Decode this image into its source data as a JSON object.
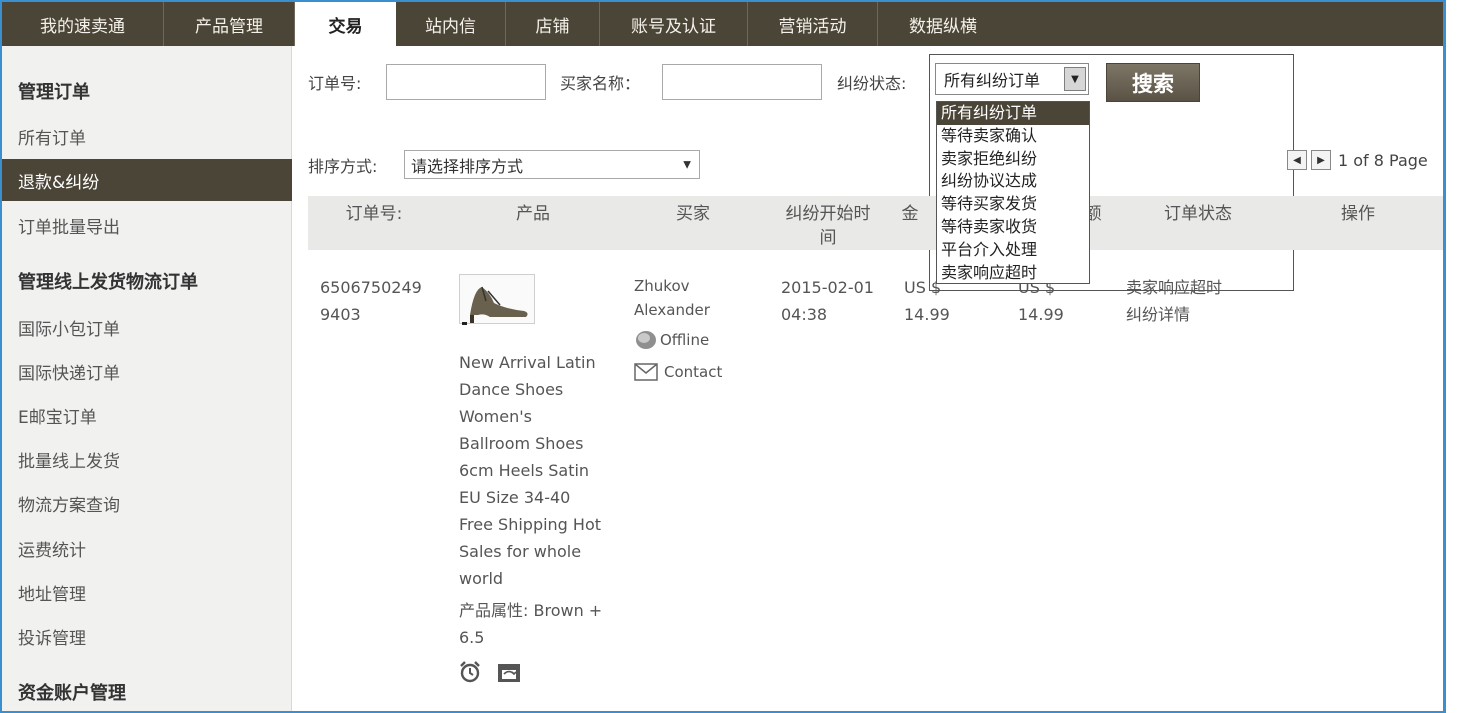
{
  "nav": {
    "tabs": [
      {
        "label": "我的速卖通"
      },
      {
        "label": "产品管理"
      },
      {
        "label": "交易"
      },
      {
        "label": "站内信"
      },
      {
        "label": "店铺"
      },
      {
        "label": "账号及认证"
      },
      {
        "label": "营销活动"
      },
      {
        "label": "数据纵横"
      }
    ],
    "active_tab": "交易"
  },
  "sidebar": {
    "items": [
      {
        "label": "管理订单"
      },
      {
        "label": "所有订单"
      },
      {
        "label": "退款&纠纷"
      },
      {
        "label": "订单批量导出"
      },
      {
        "label": "管理线上发货物流订单"
      },
      {
        "label": "国际小包订单"
      },
      {
        "label": "国际快递订单"
      },
      {
        "label": "E邮宝订单"
      },
      {
        "label": "批量线上发货"
      },
      {
        "label": "物流方案查询"
      },
      {
        "label": "运费统计"
      },
      {
        "label": "地址管理"
      },
      {
        "label": "投诉管理"
      },
      {
        "label": "资金账户管理"
      }
    ]
  },
  "filters": {
    "order_no_label": "订单号:",
    "order_no_value": "",
    "buyer_label": "买家名称：",
    "buyer_value": "",
    "status_label": "纠纷状态:",
    "status_value": "所有纠纷订单",
    "search_label": "搜索",
    "sort_label": "排序方式:",
    "sort_value": "请选择排序方式"
  },
  "status_options": [
    {
      "label": "所有纠纷订单"
    },
    {
      "label": "等待卖家确认"
    },
    {
      "label": "卖家拒绝纠纷"
    },
    {
      "label": "纠纷协议达成"
    },
    {
      "label": "等待买家发货"
    },
    {
      "label": "等待卖家收货"
    },
    {
      "label": "平台介入处理"
    },
    {
      "label": "卖家响应超时"
    }
  ],
  "pager": {
    "text": "1 of 8 Page"
  },
  "table": {
    "headers": {
      "order_no": "订单号:",
      "product": "产品",
      "buyer": "买家",
      "start_time_1": "纠纷开始时",
      "start_time_2": "间",
      "amount_partial": "金",
      "refund_partial": "额",
      "status": "订单状态",
      "action": "操作"
    },
    "row": {
      "order_no_1": "6506750249",
      "order_no_2": "9403",
      "product_lines": [
        "New Arrival Latin",
        "Dance Shoes",
        "Women's",
        "Ballroom Shoes",
        "6cm Heels Satin",
        "EU Size 34-40",
        "Free Shipping Hot",
        "Sales for whole",
        "world"
      ],
      "attr_label": "产品属性:",
      "attr_value_1": "Brown +",
      "attr_value_2": "6.5",
      "buyer_1": "Zhukov",
      "buyer_2": "Alexander",
      "online_status": "Offline",
      "contact": "Contact",
      "time_1": "2015-02-01",
      "time_2": "04:38",
      "amount_1": "US $",
      "amount_2": "14.99",
      "refund_1": "US $",
      "refund_2": "14.99",
      "status": "卖家响应超时",
      "detail_link": "纠纷详情"
    }
  },
  "colors": {
    "nav_bg": "#4b4538",
    "active_sidebar": "#4b4538",
    "frame_border": "#3a8fd0",
    "header_bg": "#e9e9e8"
  }
}
